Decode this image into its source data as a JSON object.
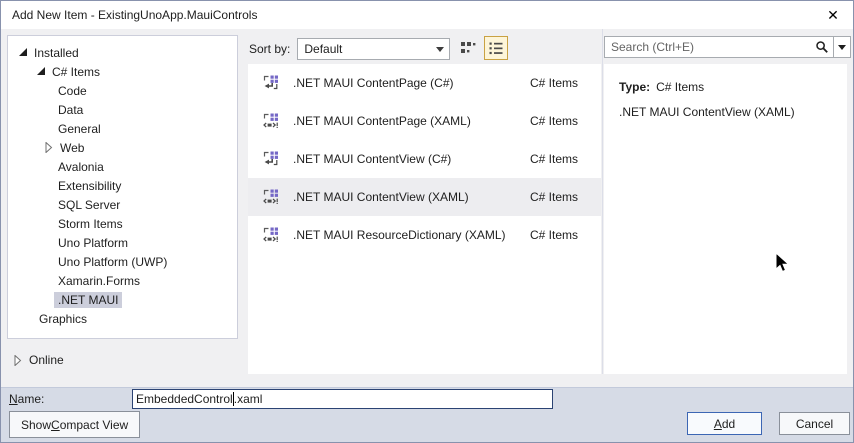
{
  "window": {
    "title": "Add New Item - ExistingUnoApp.MauiControls",
    "close_icon": "✕"
  },
  "left_panel": {
    "tree": [
      {
        "label": "Installed",
        "level": 0,
        "state": "expanded"
      },
      {
        "label": "C# Items",
        "level": 1,
        "state": "expanded"
      },
      {
        "label": "Code",
        "level": 2,
        "state": "leaf"
      },
      {
        "label": "Data",
        "level": 2,
        "state": "leaf"
      },
      {
        "label": "General",
        "level": 2,
        "state": "leaf"
      },
      {
        "label": "Web",
        "level": 2,
        "state": "collapsed"
      },
      {
        "label": "Avalonia",
        "level": 2,
        "state": "leaf"
      },
      {
        "label": "Extensibility",
        "level": 2,
        "state": "leaf"
      },
      {
        "label": "SQL Server",
        "level": 2,
        "state": "leaf"
      },
      {
        "label": "Storm Items",
        "level": 2,
        "state": "leaf"
      },
      {
        "label": "Uno Platform",
        "level": 2,
        "state": "leaf"
      },
      {
        "label": "Uno Platform (UWP)",
        "level": 2,
        "state": "leaf"
      },
      {
        "label": "Xamarin.Forms",
        "level": 2,
        "state": "leaf"
      },
      {
        "label": ".NET MAUI",
        "level": 2,
        "state": "leaf",
        "selected": true
      },
      {
        "label": "Graphics",
        "level": 1,
        "state": "leaf"
      }
    ],
    "online": {
      "label": "Online",
      "state": "collapsed"
    }
  },
  "toolbar": {
    "sort_by_label": "Sort by:",
    "sort_value": "Default"
  },
  "template_list": [
    {
      "name": ".NET MAUI ContentPage (C#)",
      "category": "C# Items",
      "icon": "csharp-template-icon"
    },
    {
      "name": ".NET MAUI ContentPage (XAML)",
      "category": "C# Items",
      "icon": "xaml-template-icon"
    },
    {
      "name": ".NET MAUI ContentView (C#)",
      "category": "C# Items",
      "icon": "csharp-template-icon"
    },
    {
      "name": ".NET MAUI ContentView (XAML)",
      "category": "C# Items",
      "icon": "xaml-template-icon",
      "selected": true
    },
    {
      "name": ".NET MAUI ResourceDictionary (XAML)",
      "category": "C# Items",
      "icon": "xaml-template-icon"
    }
  ],
  "right_panel": {
    "search_placeholder": "Search (Ctrl+E)",
    "type_label": "Type:",
    "type_value": "C# Items",
    "description": ".NET MAUI ContentView (XAML)"
  },
  "footer": {
    "name_label_mnemonic": "N",
    "name_label_rest": "ame:",
    "name_before_caret": "EmbeddedControl",
    "name_after_caret": ".xaml",
    "compact_pre": "Show ",
    "compact_mnemonic": "C",
    "compact_rest": "ompact View",
    "add_mnemonic": "A",
    "add_rest": "dd",
    "cancel_label": "Cancel"
  },
  "colors": {
    "tree_selection": "#cccedb",
    "list_selection": "#ededf0",
    "view_button_selected_bg": "#fdf5d9",
    "view_button_selected_border": "#c9a243",
    "default_button_border": "#3c66b4",
    "footer_bg": "#d6dbe6",
    "template_icon_purple": "#7568c6",
    "titlebar_bg": "#ffffff"
  }
}
